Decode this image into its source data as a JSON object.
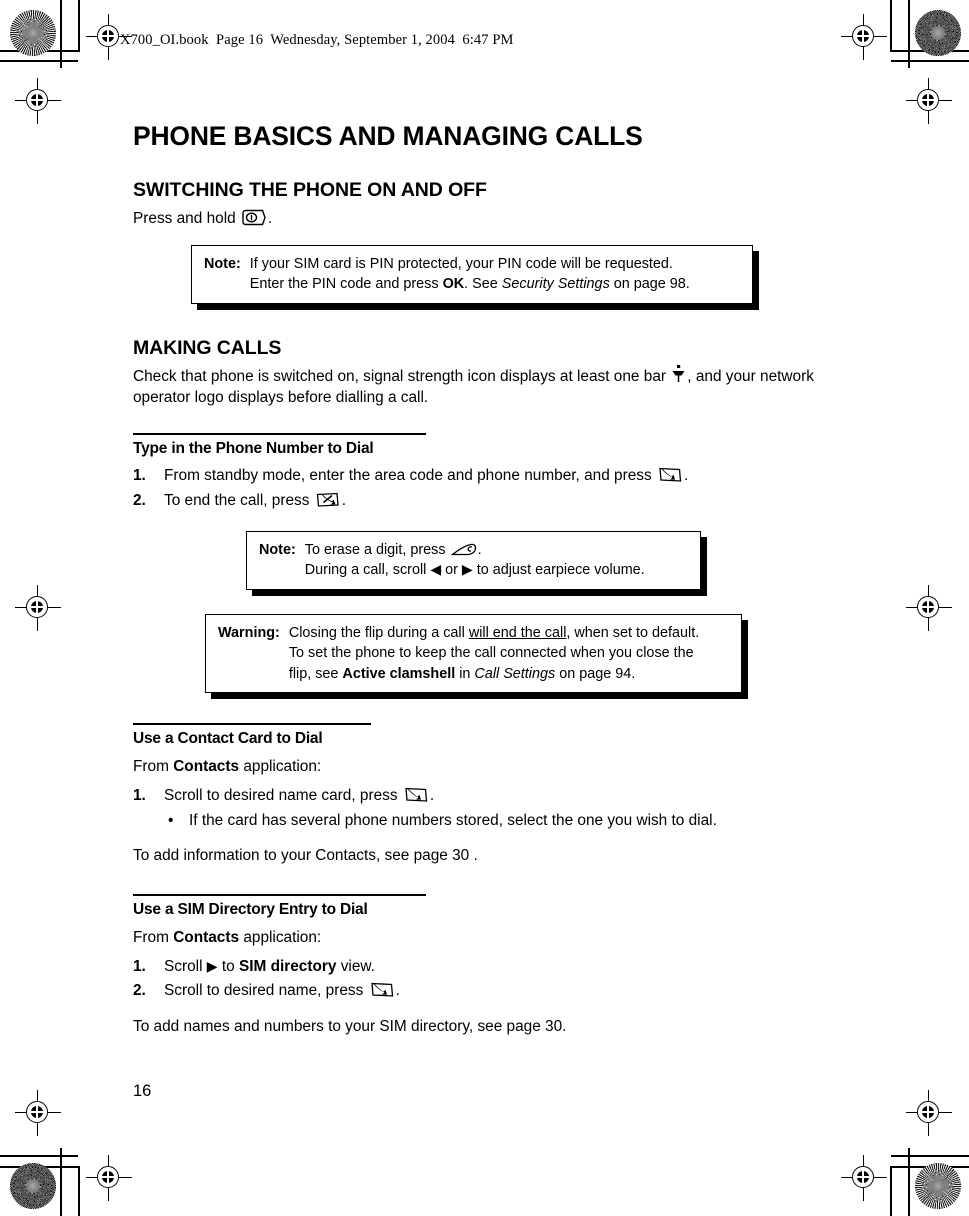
{
  "header": {
    "slug": "X700_OI.book  Page 16  Wednesday, September 1, 2004  6:47 PM"
  },
  "page_number": "16",
  "document": {
    "title": "PHONE BASICS AND MANAGING CALLS",
    "sections": [
      {
        "heading": "SWITCHING THE PHONE ON AND OFF",
        "intro_pre": "Press and hold ",
        "intro_post": "."
      },
      {
        "heading": "MAKING CALLS",
        "para_a_pre": "Check that phone is switched on, signal strength icon displays at least one bar ",
        "para_a_post": ", and your network operator logo displays before dialling a call."
      }
    ]
  },
  "note_1": {
    "label": "Note:",
    "line1_a": "If your SIM card is PIN protected, your PIN code will be requested.",
    "line2_a": "Enter the PIN code and press ",
    "line2_b": "OK",
    "line2_c": ". See ",
    "line2_d": "Security Settings",
    "line2_e": " on page 98."
  },
  "subsection_type_number": {
    "heading": "Type in the Phone Number to Dial",
    "step1_pre": "From standby mode, enter the area code and phone number, and press ",
    "step1_post": ".",
    "step1_num": "1.",
    "step2_pre": "To end the call, press ",
    "step2_post": ".",
    "step2_num": "2."
  },
  "note_2": {
    "label": "Note:",
    "line1_pre": "To erase a digit, press ",
    "line1_post": ".",
    "line2_a": "During a call, scroll ",
    "line2_b": " or ",
    "line2_c": " to adjust earpiece volume."
  },
  "warning": {
    "label": "Warning:",
    "line1_a": "Closing the flip during a call ",
    "line1_b": "will end the call",
    "line1_c": ", when set to default.",
    "line2": "To set the phone to keep the call connected when you close the",
    "line3_a": "flip, see ",
    "line3_b": "Active clamshell",
    "line3_c": " in ",
    "line3_d": "Call Settings",
    "line3_e": " on page 94."
  },
  "subsection_contact_card": {
    "heading": "Use a Contact Card to Dial",
    "from_pre": "From ",
    "from_bold": "Contacts",
    "from_post": " application:",
    "step1_num": "1.",
    "step1_pre": "Scroll to desired name card, press ",
    "step1_post": ".",
    "bullet_mark": "•",
    "bullet_text": "If the card has several phone numbers stored, select the one you wish to dial.",
    "closing": "To add information to your Contacts, see page 30 ."
  },
  "subsection_sim_directory": {
    "heading": "Use a SIM Directory Entry to Dial",
    "from_pre": "From ",
    "from_bold": "Contacts",
    "from_post": " application:",
    "step1_num": "1.",
    "step1_a": "Scroll ",
    "step1_b": " to ",
    "step1_c": "SIM directory",
    "step1_d": " view.",
    "step2_num": "2.",
    "step2_pre": "Scroll to desired name, press ",
    "step2_post": ".",
    "closing": "To add names and numbers to your SIM directory, see page 30."
  },
  "icons": {
    "power_key": "power-key-icon",
    "send_key": "send-call-key-icon",
    "end_key": "end-call-key-icon",
    "clear_key": "clear-key-icon",
    "signal_strength": "signal-strength-icon",
    "scroll_left": "◀",
    "scroll_right": "▶"
  },
  "colors": {
    "ink": "#000000",
    "paper": "#ffffff"
  }
}
